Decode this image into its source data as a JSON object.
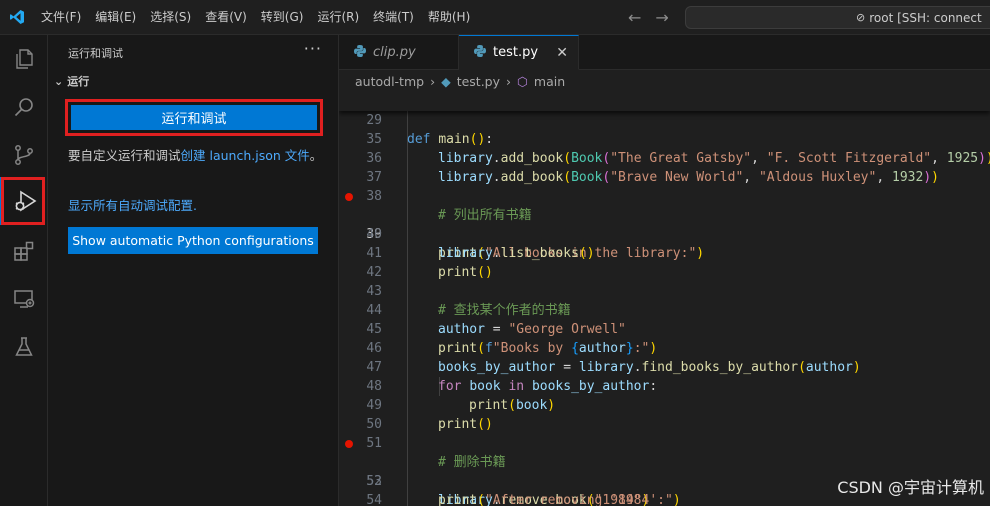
{
  "menu": [
    "文件(F)",
    "编辑(E)",
    "选择(S)",
    "查看(V)",
    "转到(G)",
    "运行(R)",
    "终端(T)",
    "帮助(H)"
  ],
  "command_center": "root [SSH: connect",
  "sidebar": {
    "title": "运行和调试",
    "section": "运行",
    "run_button": "运行和调试",
    "text_prefix": "要自定义运行和调试",
    "text_link": "创建 launch.json 文件",
    "text_suffix": "。",
    "show_all": "显示所有自动调试配置.",
    "python_button": "Show automatic Python configurations"
  },
  "tabs": [
    {
      "label": "clip.py",
      "active": false
    },
    {
      "label": "test.py",
      "active": true
    }
  ],
  "breadcrumb": [
    "autodl-tmp",
    "test.py",
    "main"
  ],
  "code_lines": [
    {
      "n": "29",
      "sticky": true
    },
    {
      "n": "35"
    },
    {
      "n": "36"
    },
    {
      "n": "37"
    },
    {
      "n": "38"
    },
    {
      "n": "39",
      "bp": true,
      "cur": true
    },
    {
      "n": "40"
    },
    {
      "n": "41"
    },
    {
      "n": "42"
    },
    {
      "n": "43"
    },
    {
      "n": "44"
    },
    {
      "n": "45"
    },
    {
      "n": "46"
    },
    {
      "n": "47"
    },
    {
      "n": "48"
    },
    {
      "n": "49"
    },
    {
      "n": "50"
    },
    {
      "n": "51"
    },
    {
      "n": "52",
      "bp": true
    },
    {
      "n": "53"
    },
    {
      "n": "54"
    }
  ],
  "watermark": "CSDN @宇宙计算机",
  "colors": {
    "accent": "#0078d4",
    "highlight_box": "#e02020",
    "breakpoint": "#e51400",
    "link": "#4daafc"
  }
}
